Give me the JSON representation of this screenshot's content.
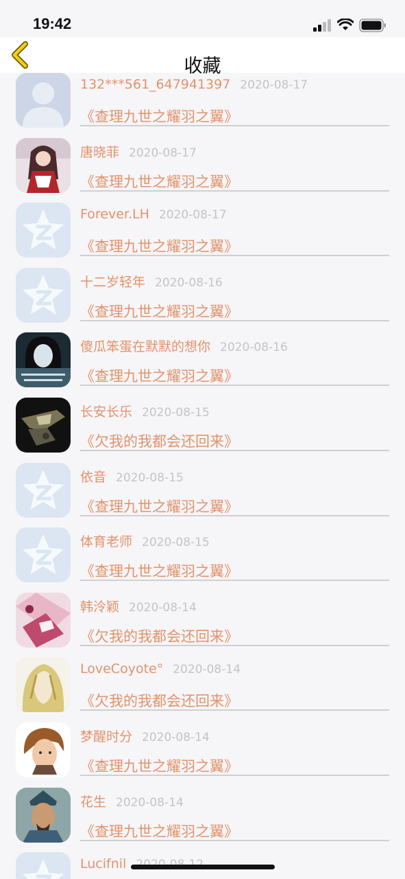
{
  "status_bar": {
    "time": "19:42"
  },
  "nav": {
    "title": "收藏"
  },
  "items": [
    {
      "user": "132***561_647941397",
      "date": "2020-08-17",
      "title": "《查理九世之耀羽之翼》",
      "avatar": "default-avatar"
    },
    {
      "user": "唐晓菲",
      "date": "2020-08-17",
      "title": "《查理九世之耀羽之翼》",
      "avatar": "anime-girl-red"
    },
    {
      "user": "Forever.LH",
      "date": "2020-08-17",
      "title": "《查理九世之耀羽之翼》",
      "avatar": "qzone-star"
    },
    {
      "user": "十二岁轻年",
      "date": "2020-08-16",
      "title": "《查理九世之耀羽之翼》",
      "avatar": "qzone-star"
    },
    {
      "user": "傻瓜笨蛋在默默的想你",
      "date": "2020-08-16",
      "title": "《查理九世之耀羽之翼》",
      "avatar": "girl-photo"
    },
    {
      "user": "长安长乐",
      "date": "2020-08-15",
      "title": "《欠我的我都会还回来》",
      "avatar": "dark-robot"
    },
    {
      "user": "依音",
      "date": "2020-08-15",
      "title": "《查理九世之耀羽之翼》",
      "avatar": "qzone-star"
    },
    {
      "user": "体育老师",
      "date": "2020-08-15",
      "title": "《查理九世之耀羽之翼》",
      "avatar": "qzone-star"
    },
    {
      "user": "韩泠颖",
      "date": "2020-08-14",
      "title": "《欠我的我都会还回来》",
      "avatar": "pink-anime"
    },
    {
      "user": "LoveCoyote°",
      "date": "2020-08-14",
      "title": "《欠我的我都会还回来》",
      "avatar": "blonde-anime"
    },
    {
      "user": "梦醒时分",
      "date": "2020-08-14",
      "title": "《查理九世之耀羽之翼》",
      "avatar": "brown-hair-anime"
    },
    {
      "user": "花生",
      "date": "2020-08-14",
      "title": "《查理九世之耀羽之翼》",
      "avatar": "warrior-portrait"
    },
    {
      "user": "Lucifnil",
      "date": "2020-08-12",
      "title": "",
      "avatar": "qzone-star"
    }
  ],
  "colors": {
    "accent": "#e2936a",
    "date": "#c4c4c4",
    "back": "#d8b800"
  }
}
